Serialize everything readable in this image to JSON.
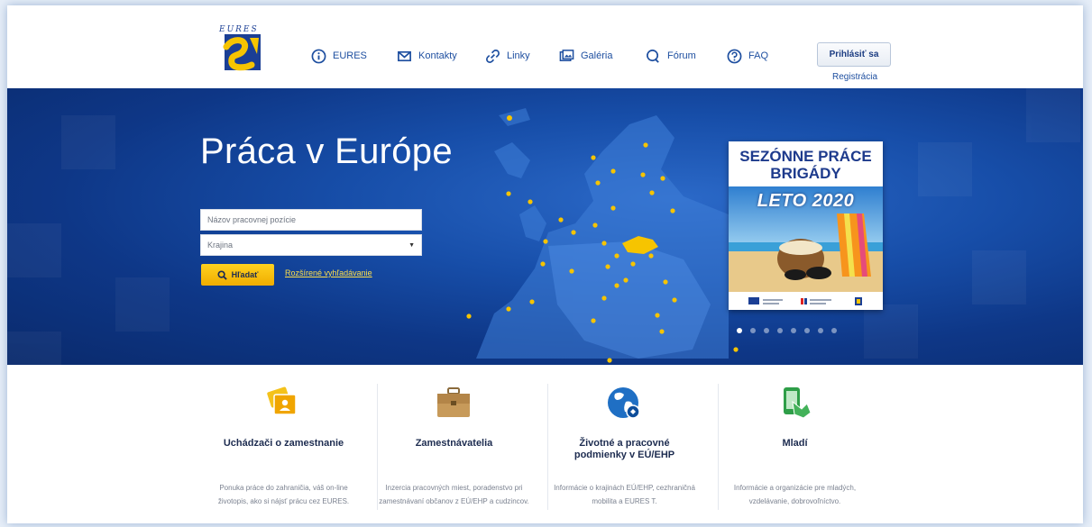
{
  "header": {
    "logo_text": "EURES",
    "nav": [
      {
        "label": "EURES",
        "icon": "info-icon"
      },
      {
        "label": "Kontakty",
        "icon": "envelope-icon"
      },
      {
        "label": "Linky",
        "icon": "link-icon"
      },
      {
        "label": "Galéria",
        "icon": "gallery-icon"
      },
      {
        "label": "Fórum",
        "icon": "forum-icon"
      },
      {
        "label": "FAQ",
        "icon": "help-icon"
      }
    ],
    "login_label": "Prihlásiť sa",
    "register_label": "Registrácia"
  },
  "hero": {
    "title": "Práca v Európe",
    "job_title_placeholder": "Názov pracovnej pozície",
    "country_value": "Krajina",
    "search_label": "Hľadať",
    "advanced_search_label": "Rozšírené vyhľadávanie",
    "promo": {
      "line1": "SEZÓNNE PRÁCE",
      "line2": "BRIGÁDY",
      "year": "LETO 2020"
    },
    "carousel": {
      "count": 8,
      "active_index": 0
    }
  },
  "cards": [
    {
      "title": "Uchádzači o zamestnanie",
      "desc": "Ponuka práce do zahraničia, váš on-line životopis, ako si nájsť prácu cez EURES.",
      "icon": "job-seeker-icon"
    },
    {
      "title": "Zamestnávatelia",
      "desc": "Inzercia pracovných miest, poradenstvo pri zamestnávaní občanov z EÚ/EHP a cudzincov.",
      "icon": "briefcase-icon"
    },
    {
      "title": "Životné a pracovné podmienky v EÚ/EHP",
      "desc": "Informácie o krajinách EÚ/EHP, cezhraničná mobilita a EURES T.",
      "icon": "globe-icon"
    },
    {
      "title": "Mladí",
      "desc": "Informácie a organizácie pre mladých, vzdelávanie, dobrovoľníctvo.",
      "icon": "youth-icon"
    }
  ],
  "colors": {
    "brand_blue": "#1e4fa0",
    "hero_blue": "#174ea9",
    "accent_yellow": "#f6c400"
  }
}
